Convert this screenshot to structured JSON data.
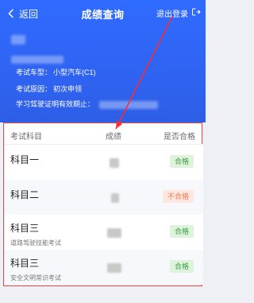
{
  "nav": {
    "back_label": "返回",
    "title": "成绩查询",
    "logout_label": "退出登录"
  },
  "info": {
    "vehicle_type_label": "考试车型：",
    "vehicle_type_value": "小型汽车(C1)",
    "exam_reason_label": "考试原因：",
    "exam_reason_value": "初次申领",
    "permit_valid_label": "学习驾驶证明有效期止："
  },
  "table": {
    "headers": [
      "考试科目",
      "成绩",
      "是否合格"
    ],
    "rows": [
      {
        "subject": "科目一",
        "sub": "",
        "status": "合格",
        "status_type": "pass"
      },
      {
        "subject": "科目二",
        "sub": "",
        "status": "不合格",
        "status_type": "fail"
      },
      {
        "subject": "科目三",
        "sub": "道路驾驶技能考试",
        "status": "合格",
        "status_type": "pass"
      },
      {
        "subject": "科目三",
        "sub": "安全文明常识考试",
        "status": "合格",
        "status_type": "pass"
      }
    ]
  },
  "colors": {
    "header_blue": "#2f63f2",
    "highlight_red": "#ff3b3b",
    "pass_green": "#3aa043",
    "fail_orange": "#f07a50"
  },
  "icons": {
    "back": "chevron-left-icon",
    "logout": "logout-icon"
  }
}
